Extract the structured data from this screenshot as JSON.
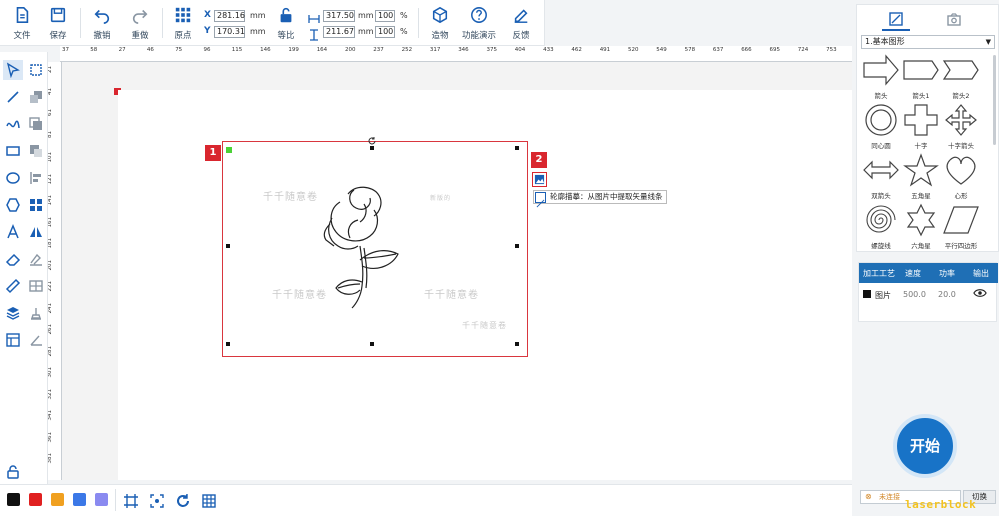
{
  "toolbar": {
    "file": "文件",
    "save": "保存",
    "undo": "撤销",
    "redo": "重做",
    "origin": "原点",
    "ratio": "等比",
    "craft": "造物",
    "demo": "功能演示",
    "feedback": "反馈"
  },
  "coords": {
    "x_label": "X",
    "x_value": "281.16",
    "y_label": "Y",
    "y_value": "170.31",
    "unit": "mm",
    "width": "317.50",
    "height": "211.67",
    "w_pct": "100",
    "h_pct": "100",
    "pct": "%"
  },
  "ruler_top": [
    "37",
    "58",
    "27",
    "46",
    "75",
    "96",
    "115",
    "146",
    "199",
    "164",
    "200",
    "237",
    "252",
    "317",
    "346",
    "375",
    "404",
    "433",
    "462",
    "491",
    "520",
    "549",
    "578",
    "637",
    "666",
    "695",
    "724",
    "753",
    "782",
    "811",
    "840"
  ],
  "ruler_left": [
    "21",
    "41",
    "61",
    "81",
    "101",
    "121",
    "141",
    "161",
    "181",
    "201",
    "221",
    "241",
    "261",
    "281",
    "301",
    "321",
    "341",
    "361",
    "381"
  ],
  "canvas": {
    "badge1": "1",
    "badge2": "2",
    "tooltip": "轮廓描摹：从图片中提取矢量线条",
    "wm1": "千千随意卷",
    "wm2": "千千随意卷",
    "wm3": "千千随意卷",
    "wm4": "千千随意卷",
    "wm5": "新版的"
  },
  "colors": [
    "#111111",
    "#e02020",
    "#f0a020",
    "#3b78e7",
    "#8a8af0"
  ],
  "panel": {
    "category": "1.基本图形",
    "shapes": [
      "箭头",
      "箭头1",
      "箭头2",
      "同心圆",
      "十字",
      "十字箭头",
      "双箭头",
      "五角星",
      "心形",
      "螺旋线",
      "六角星",
      "平行四边形"
    ]
  },
  "table": {
    "headers": [
      "加工工艺",
      "速度",
      "功率",
      "输出"
    ],
    "row": {
      "name": "图片",
      "speed": "500.0",
      "power": "20.0",
      "color": "#111111"
    }
  },
  "start": "开始",
  "bottom": {
    "field": "未连接",
    "switch": "切换",
    "watermark": "laserblock"
  }
}
